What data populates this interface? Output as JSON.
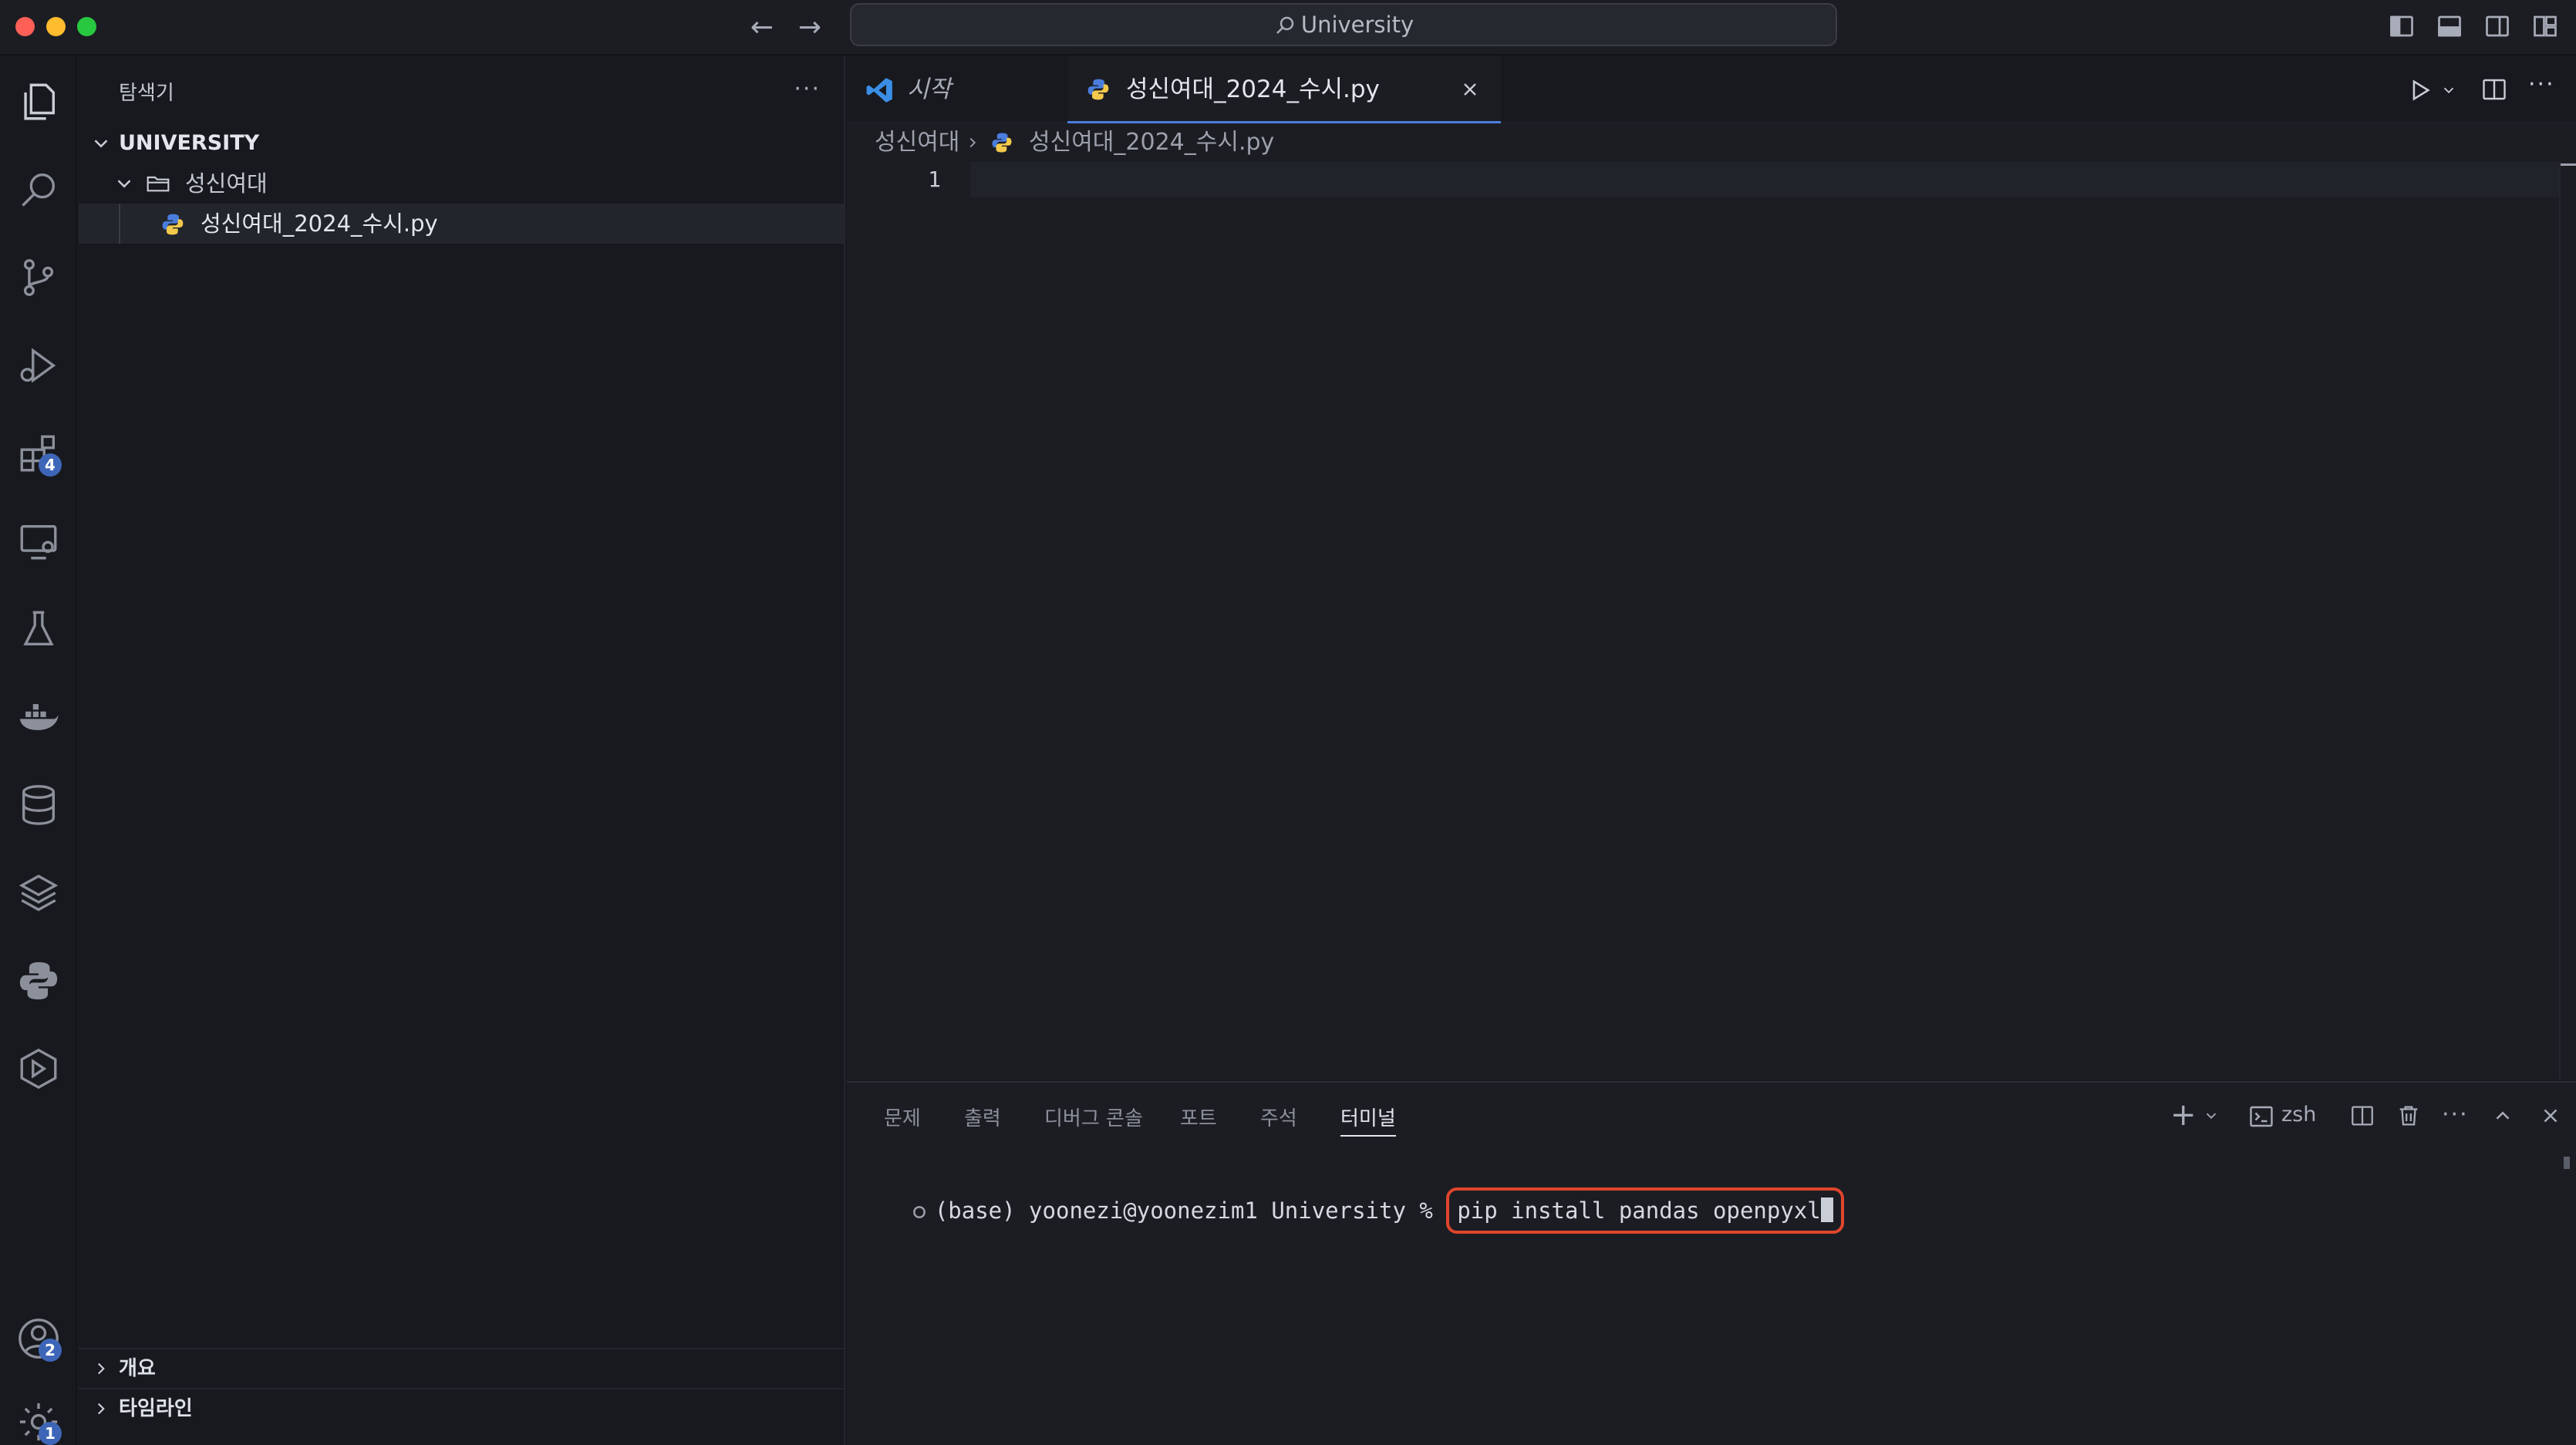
{
  "window": {
    "search_text": "University"
  },
  "activity_bar": {
    "extensions_badge": "4",
    "accounts_badge": "2",
    "settings_badge": "1"
  },
  "sidebar": {
    "title": "탐색기",
    "root": "UNIVERSITY",
    "folder": "성신여대",
    "file": "성신여대_2024_수시.py",
    "bottom_sections": [
      "개요",
      "타임라인"
    ]
  },
  "editor": {
    "tabs": [
      {
        "label": "시작",
        "active": false
      },
      {
        "label": "성신여대_2024_수시.py",
        "active": true
      }
    ],
    "breadcrumb": [
      "성신여대",
      "성신여대_2024_수시.py"
    ],
    "line_number": "1"
  },
  "panel": {
    "tabs": [
      "문제",
      "출력",
      "디버그 콘솔",
      "포트",
      "주석",
      "터미널"
    ],
    "active_tab": "터미널",
    "shell": "zsh",
    "prompt": "(base) yoonezi@yoonezim1 University % ",
    "command": "pip install pandas openpyxl"
  },
  "colors": {
    "accent": "#4a7ddc",
    "highlight_box": "#e0452c",
    "badge": "#3e66b8"
  }
}
